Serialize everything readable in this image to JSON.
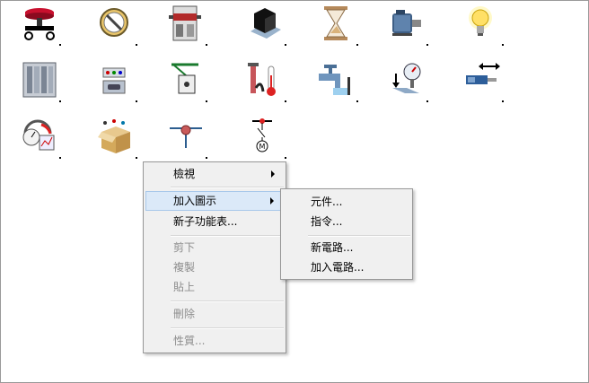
{
  "toolbox": {
    "icons": [
      "emergency-stop-icon",
      "circuit-breaker-icon",
      "terminal-block-icon",
      "black-box-device-icon",
      "hourglass-timer-icon",
      "motor-icon",
      "light-bulb-icon",
      "plc-rack-icon",
      "connector-block-icon",
      "relay-contact-icon",
      "pressure-temperature-sensor-icon",
      "water-valve-icon",
      "pressure-gauge-switch-icon",
      "linear-actuator-icon",
      "gauge-meters-icon",
      "package-box-icon",
      "junction-node-icon",
      "motor-switch-icon"
    ]
  },
  "context_menu": {
    "items": [
      {
        "label": "檢視",
        "submenu": true
      },
      {
        "label": "加入圖示",
        "submenu": true,
        "highlighted": true
      },
      {
        "label": "新子功能表..."
      },
      {
        "label": "剪下",
        "disabled": true
      },
      {
        "label": "複製",
        "disabled": true
      },
      {
        "label": "貼上",
        "disabled": true
      },
      {
        "label": "刪除",
        "disabled": true
      },
      {
        "label": "性質...",
        "disabled": true
      }
    ]
  },
  "submenu": {
    "items": [
      {
        "label": "元件..."
      },
      {
        "label": "指令..."
      },
      {
        "label": "新電路..."
      },
      {
        "label": "加入電路..."
      }
    ]
  },
  "colors": {
    "menu_bg": "#f0f0f0",
    "highlight": "#dbe9f8",
    "disabled_text": "#8d8d8d"
  }
}
